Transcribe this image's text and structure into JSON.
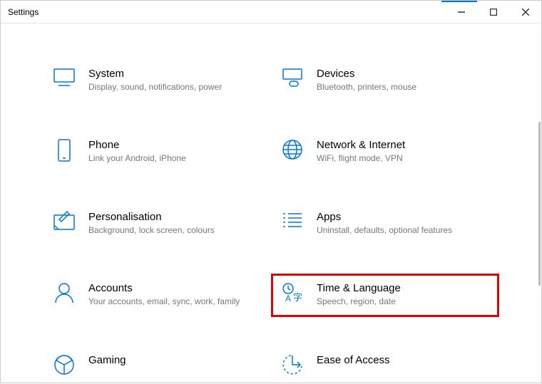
{
  "window": {
    "title": "Settings"
  },
  "tiles": [
    {
      "title": "System",
      "desc": "Display, sound, notifications, power"
    },
    {
      "title": "Devices",
      "desc": "Bluetooth, printers, mouse"
    },
    {
      "title": "Phone",
      "desc": "Link your Android, iPhone"
    },
    {
      "title": "Network & Internet",
      "desc": "WiFi, flight mode, VPN"
    },
    {
      "title": "Personalisation",
      "desc": "Background, lock screen, colours"
    },
    {
      "title": "Apps",
      "desc": "Uninstall, defaults, optional features"
    },
    {
      "title": "Accounts",
      "desc": "Your accounts, email, sync, work, family"
    },
    {
      "title": "Time & Language",
      "desc": "Speech, region, date"
    },
    {
      "title": "Gaming",
      "desc": ""
    },
    {
      "title": "Ease of Access",
      "desc": ""
    }
  ],
  "highlighted_index": 7
}
